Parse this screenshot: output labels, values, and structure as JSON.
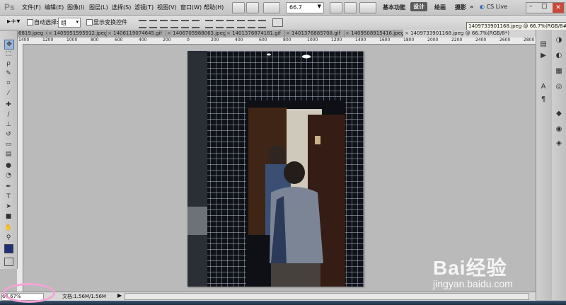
{
  "app": {
    "logo": "Ps"
  },
  "menu": [
    {
      "label": "文件(F)"
    },
    {
      "label": "编辑(E)"
    },
    {
      "label": "图像(I)"
    },
    {
      "label": "图层(L)"
    },
    {
      "label": "选择(S)"
    },
    {
      "label": "滤镜(T)"
    },
    {
      "label": "视图(V)"
    },
    {
      "label": "窗口(W)"
    },
    {
      "label": "帮助(H)"
    }
  ],
  "menubar_right": {
    "zoom_value": "66.7",
    "workspace_basic": "基本功能",
    "workspace_design": "设计",
    "workspace_painting": "绘画",
    "workspace_photo": "摄影",
    "cs_live": "CS Live"
  },
  "options": {
    "auto_select_label": "自动选择:",
    "auto_select_value": "组",
    "show_transform_label": "显示变换控件"
  },
  "tabs": [
    {
      "label": "6819.jpeg"
    },
    {
      "label": "1405951595912.jpeg"
    },
    {
      "label": "1406119074645.gif"
    },
    {
      "label": "1406705988063.jpeg"
    },
    {
      "label": "1401376874181.gif"
    },
    {
      "label": "1401376885708.gif"
    },
    {
      "label": "1409508915416.jpeg"
    },
    {
      "label": "1409733901168.jpeg @ 66.7%(RGB/8*)"
    }
  ],
  "tooltip": "1409733901168.jpeg @ 66.7%(RGB/8#)",
  "ruler_labels": [
    "1400",
    "1200",
    "1000",
    "800",
    "600",
    "400",
    "200",
    "0",
    "200",
    "400",
    "600",
    "800",
    "1000",
    "1200",
    "1400",
    "1600",
    "1800",
    "2000",
    "2200",
    "2400",
    "2600",
    "2800"
  ],
  "status": {
    "zoom": "66.67%",
    "doc": "文档:1.56M/1.56M"
  },
  "colors": {
    "foreground": "#1f2f7a",
    "background": "#ffffff",
    "annotation": "#f4a3d6",
    "active_workspace": "#5a5a5a"
  },
  "icons": {
    "tools": [
      "move-icon",
      "marquee-icon",
      "lasso-icon",
      "quick-select-icon",
      "crop-icon",
      "eyedropper-icon",
      "healing-icon",
      "brush-icon",
      "clone-stamp-icon",
      "history-brush-icon",
      "eraser-icon",
      "gradient-icon",
      "blur-icon",
      "dodge-icon",
      "pen-icon",
      "type-icon",
      "path-select-icon",
      "shape-icon",
      "hand-icon",
      "zoom-icon"
    ]
  },
  "watermark": {
    "logo": "Bai经验",
    "url": "jingyan.baidu.com"
  }
}
